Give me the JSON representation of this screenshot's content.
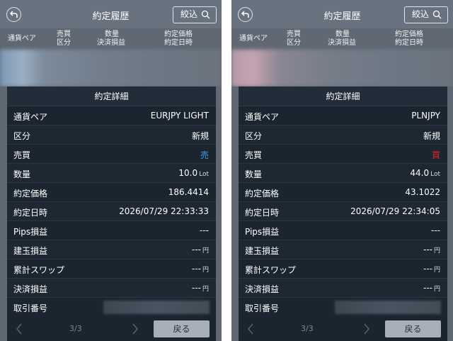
{
  "screens": [
    {
      "header": {
        "title": "約定履歴",
        "filter_label": "絞込"
      },
      "columns": {
        "pair": "通貨ペア",
        "side_line1": "売買",
        "side_line2": "区分",
        "qty_line1": "数量",
        "qty_line2": "決済損益",
        "price_line1": "約定価格",
        "price_line2": "約定日時"
      },
      "dialog": {
        "title": "約定詳細",
        "rows": {
          "pair": {
            "label": "通貨ペア",
            "value": "EURJPY LIGHT"
          },
          "category": {
            "label": "区分",
            "value": "新規"
          },
          "side": {
            "label": "売買",
            "value": "売"
          },
          "quantity": {
            "label": "数量",
            "value": "10.0",
            "unit": "Lot"
          },
          "price": {
            "label": "約定価格",
            "value": "186.4414"
          },
          "datetime": {
            "label": "約定日時",
            "value": "2026/07/29 22:33:33"
          },
          "pips": {
            "label": "Pips損益",
            "value": "---"
          },
          "position_pl": {
            "label": "建玉損益",
            "value": "---",
            "unit": "円"
          },
          "swap": {
            "label": "累計スワップ",
            "value": "---",
            "unit": "円"
          },
          "settle_pl": {
            "label": "決済損益",
            "value": "---",
            "unit": "円"
          },
          "trade_no": {
            "label": "取引番号"
          }
        },
        "pager": {
          "count": "3/3",
          "back_label": "戻る"
        }
      }
    },
    {
      "header": {
        "title": "約定履歴",
        "filter_label": "絞込"
      },
      "columns": {
        "pair": "通貨ペア",
        "side_line1": "売買",
        "side_line2": "区分",
        "qty_line1": "数量",
        "qty_line2": "決済損益",
        "price_line1": "約定価格",
        "price_line2": "約定日時"
      },
      "dialog": {
        "title": "約定詳細",
        "rows": {
          "pair": {
            "label": "通貨ペア",
            "value": "PLNJPY"
          },
          "category": {
            "label": "区分",
            "value": "新規"
          },
          "side": {
            "label": "売買",
            "value": "買"
          },
          "quantity": {
            "label": "数量",
            "value": "44.0",
            "unit": "Lot"
          },
          "price": {
            "label": "約定価格",
            "value": "43.1022"
          },
          "datetime": {
            "label": "約定日時",
            "value": "2026/07/29 22:34:05"
          },
          "pips": {
            "label": "Pips損益",
            "value": "---"
          },
          "position_pl": {
            "label": "建玉損益",
            "value": "---",
            "unit": "円"
          },
          "swap": {
            "label": "累計スワップ",
            "value": "---",
            "unit": "円"
          },
          "settle_pl": {
            "label": "決済損益",
            "value": "---",
            "unit": "円"
          },
          "trade_no": {
            "label": "取引番号"
          }
        },
        "pager": {
          "count": "3/3",
          "back_label": "戻る"
        }
      }
    }
  ],
  "colors": {
    "sell": "#3aa0e0",
    "buy": "#e0262a",
    "dialog_bg": "#1b2530",
    "app_bg": "#636c77"
  }
}
